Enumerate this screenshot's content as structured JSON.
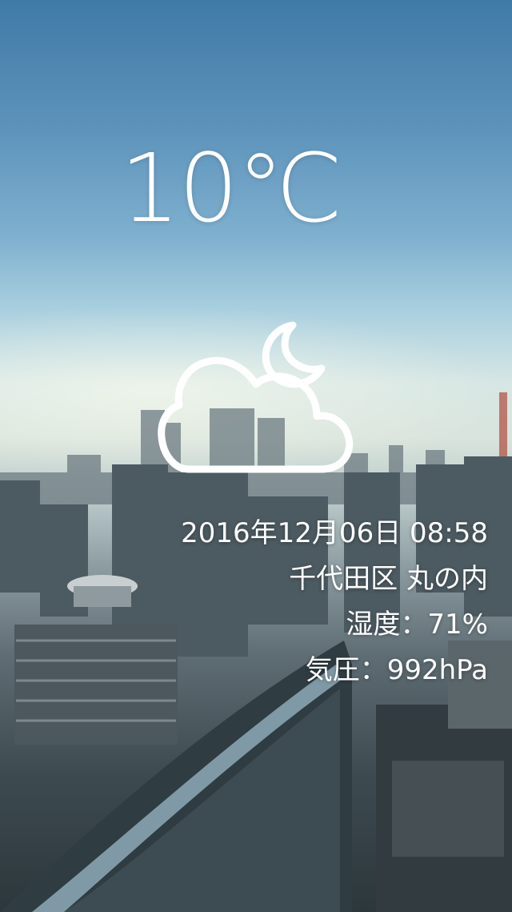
{
  "weather": {
    "temperature": "10℃",
    "condition_icon": "cloud-moon-icon",
    "datetime": "2016年12月06日 08:58",
    "location": "千代田区 丸の内",
    "humidity": "湿度：71%",
    "pressure": "気圧：992hPa"
  },
  "colors": {
    "text": "#ffffff",
    "sky_top": "#3f7aa6",
    "sky_horizon": "#d6e6e4"
  }
}
